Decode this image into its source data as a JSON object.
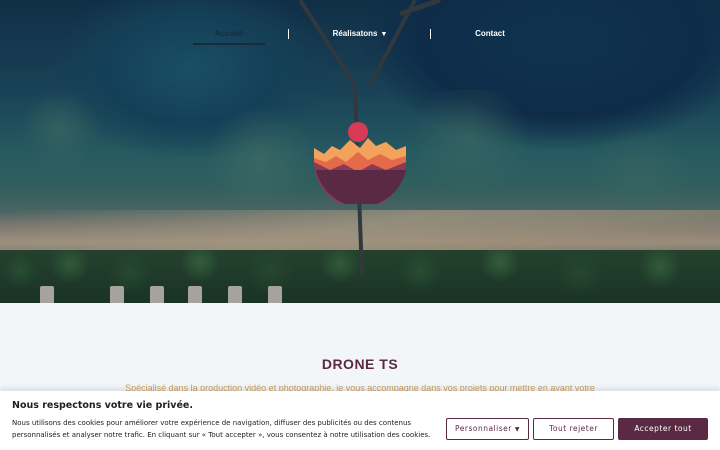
{
  "nav": {
    "items": [
      {
        "label": "Accueil",
        "active": true
      },
      {
        "label": "Réalisatons",
        "has_dropdown": true
      },
      {
        "label": "Contact"
      }
    ],
    "separator": "|",
    "dropdown_icon": "chevron-down-icon"
  },
  "hero": {
    "logo_icon": "sun-mountain-logo",
    "colors": {
      "sun": "#d63a55",
      "mountain_light": "#f2a25a",
      "mountain_mid": "#e36b4a",
      "mountain_dark": "#8a3a55",
      "base": "#5a2a44"
    }
  },
  "main": {
    "title": "DRONE TS",
    "intro": "Spécialisé dans la production vidéo et photographie, je vous accompagne dans vos projets pour mettre en avant votre"
  },
  "cookie_banner": {
    "title": "Nous respectons votre vie privée.",
    "text": "Nous utilisons des cookies pour améliorer votre expérience de navigation, diffuser des publicités ou des contenus personnalisés et analyser notre trafic. En cliquant sur « Tout accepter », vous consentez à notre utilisation des cookies.",
    "customize_label": "Personnaliser",
    "reject_label": "Tout rejeter",
    "accept_label": "Accepter tout",
    "accent_color": "#5a2a44"
  }
}
